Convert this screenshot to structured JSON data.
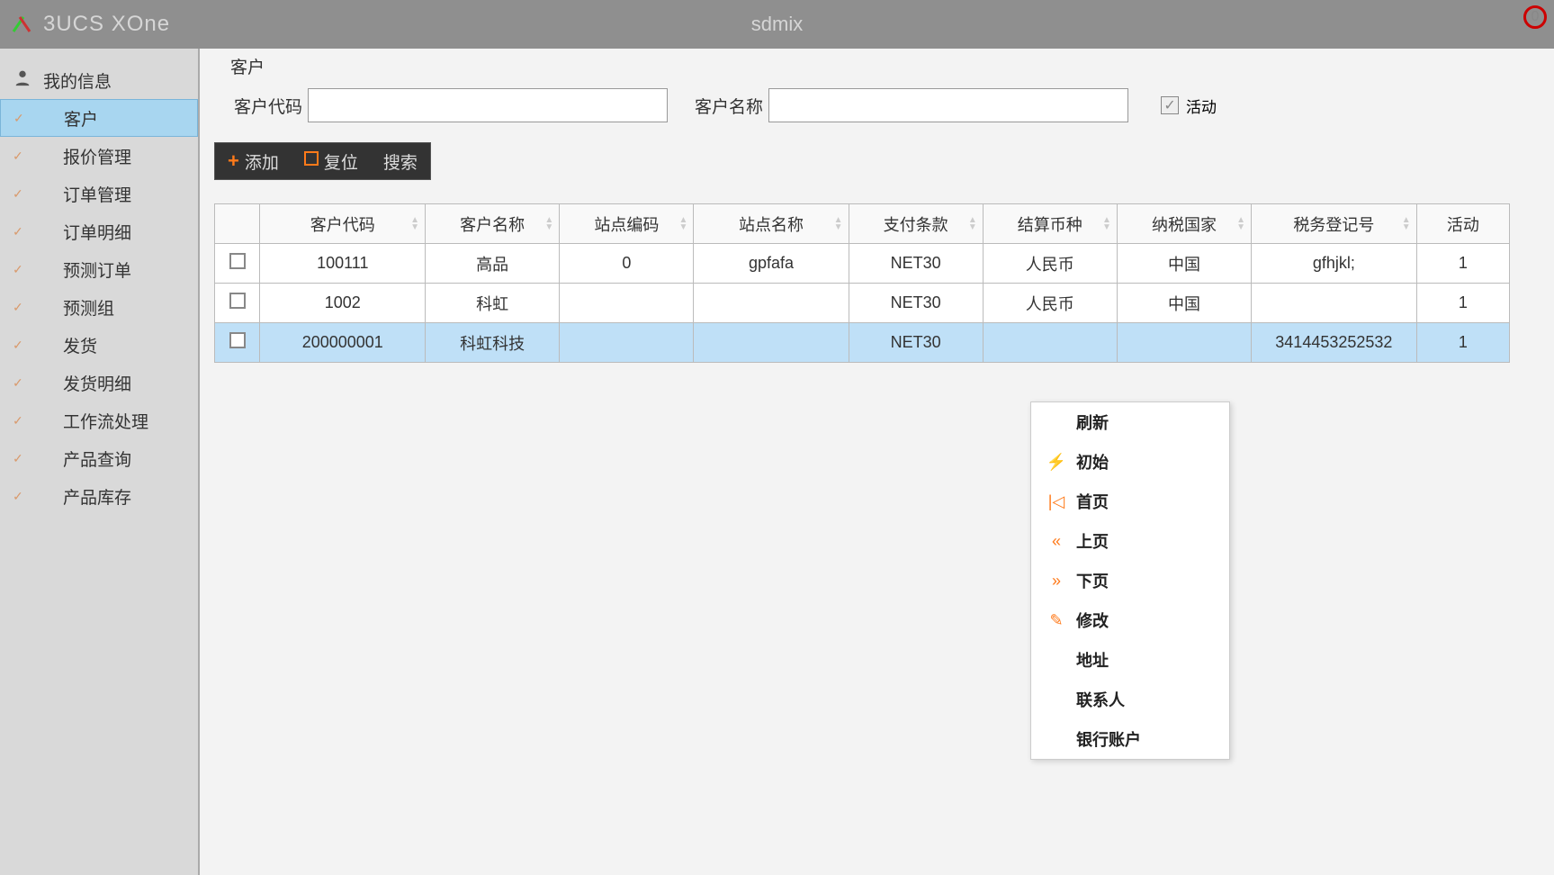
{
  "titlebar": {
    "app_title": "3UCS XOne",
    "center": "sdmix",
    "badge": "0"
  },
  "sidebar": {
    "header": "我的信息",
    "items": [
      "客户",
      "报价管理",
      "订单管理",
      "订单明细",
      "预测订单",
      "预测组",
      "发货",
      "发货明细",
      "工作流处理",
      "产品查询",
      "产品库存"
    ]
  },
  "panel": {
    "legend": "客户",
    "filter_code_label": "客户代码",
    "filter_name_label": "客户名称",
    "active_label": "活动"
  },
  "toolbar": {
    "add": "添加",
    "reset": "复位",
    "search": "搜索"
  },
  "table": {
    "headers": [
      "客户代码",
      "客户名称",
      "站点编码",
      "站点名称",
      "支付条款",
      "结算币种",
      "纳税国家",
      "税务登记号",
      "活动"
    ],
    "rows": [
      {
        "code": "100111",
        "name": "高品",
        "site": "0",
        "siten": "gpfafa",
        "pay": "NET30",
        "curr": "人民币",
        "tax": "中国",
        "reg": "gfhjkl;",
        "act": "1"
      },
      {
        "code": "1002",
        "name": "科虹",
        "site": "",
        "siten": "",
        "pay": "NET30",
        "curr": "人民币",
        "tax": "中国",
        "reg": "",
        "act": "1"
      },
      {
        "code": "200000001",
        "name": "科虹科技",
        "site": "",
        "siten": "",
        "pay": "NET30",
        "curr": "",
        "tax": "",
        "reg": "3414453252532",
        "act": "1"
      }
    ]
  },
  "context_menu": {
    "items": [
      {
        "icon": "",
        "label": "刷新"
      },
      {
        "icon": "bolt",
        "label": "初始"
      },
      {
        "icon": "first",
        "label": "首页"
      },
      {
        "icon": "prev",
        "label": "上页"
      },
      {
        "icon": "next",
        "label": "下页"
      },
      {
        "icon": "edit",
        "label": "修改"
      },
      {
        "icon": "",
        "label": "地址"
      },
      {
        "icon": "",
        "label": "联系人"
      },
      {
        "icon": "",
        "label": "银行账户"
      }
    ]
  }
}
